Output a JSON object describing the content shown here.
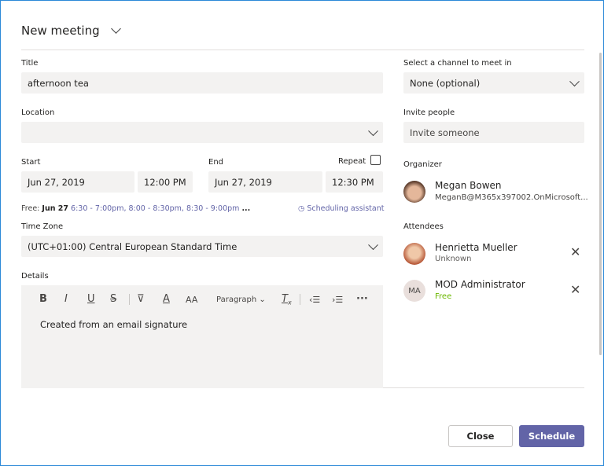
{
  "header": {
    "title": "New meeting"
  },
  "form": {
    "title_label": "Title",
    "title_value": "afternoon tea",
    "location_label": "Location",
    "location_value": "",
    "start_label": "Start",
    "start_date": "Jun 27, 2019",
    "start_time": "12:00 PM",
    "end_label": "End",
    "end_date": "Jun 27, 2019",
    "end_time": "12:30 PM",
    "repeat_label": "Repeat",
    "repeat_checked": false,
    "free_label": "Free:",
    "free_date": "Jun 27",
    "free_slots": [
      "6:30 - 7:00pm,",
      "8:00 - 8:30pm,",
      "8:30 - 9:00pm"
    ],
    "free_more": "...",
    "scheduling_assistant": "Scheduling assistant",
    "timezone_label": "Time Zone",
    "timezone_value": "(UTC+01:00) Central European Standard Time",
    "details_label": "Details",
    "details_text": "Created from an email signature",
    "toolbar": {
      "bold": "B",
      "italic": "I",
      "underline": "U",
      "strike": "S",
      "font_size": "AA",
      "paragraph": "Paragraph"
    }
  },
  "side": {
    "channel_label": "Select a channel to meet in",
    "channel_value": "None (optional)",
    "invite_label": "Invite people",
    "invite_placeholder": "Invite someone",
    "organizer_label": "Organizer",
    "organizer": {
      "name": "Megan Bowen",
      "email": "MeganB@M365x397002.OnMicrosoft..."
    },
    "attendees_label": "Attendees",
    "attendees": [
      {
        "name": "Henrietta Mueller",
        "status": "Unknown"
      },
      {
        "name": "MOD Administrator",
        "initials": "MA",
        "status": "Free",
        "status_color": "#6bb700"
      }
    ]
  },
  "footer": {
    "close": "Close",
    "schedule": "Schedule"
  },
  "colors": {
    "accent": "#6264a7"
  }
}
